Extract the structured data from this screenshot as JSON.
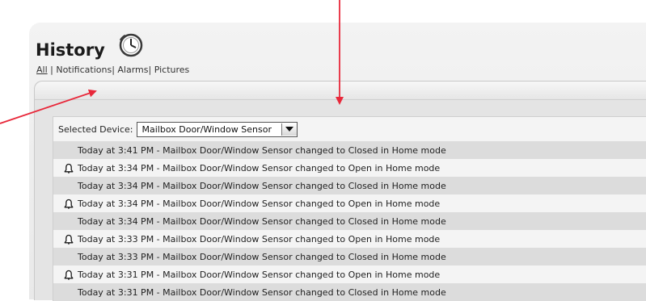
{
  "header": {
    "title": "History",
    "icon": "clock-icon"
  },
  "filters": {
    "all": "All",
    "sep1": " | ",
    "notifications": "Notifications",
    "sep2": "| ",
    "alarms": "Alarms",
    "sep3": "| ",
    "pictures": "Pictures",
    "active": "All"
  },
  "device": {
    "label": "Selected Device:",
    "selected": "Mailbox Door/Window Sensor"
  },
  "events": [
    {
      "text": "Today at 3:41 PM - Mailbox Door/Window Sensor changed to Closed in Home mode",
      "alert": false
    },
    {
      "text": "Today at 3:34 PM - Mailbox Door/Window Sensor changed to Open in Home mode",
      "alert": true
    },
    {
      "text": "Today at 3:34 PM - Mailbox Door/Window Sensor changed to Closed in Home mode",
      "alert": false
    },
    {
      "text": "Today at 3:34 PM - Mailbox Door/Window Sensor changed to Open in Home mode",
      "alert": true
    },
    {
      "text": "Today at 3:34 PM - Mailbox Door/Window Sensor changed to Closed in Home mode",
      "alert": false
    },
    {
      "text": "Today at 3:33 PM - Mailbox Door/Window Sensor changed to Open in Home mode",
      "alert": true
    },
    {
      "text": "Today at 3:33 PM - Mailbox Door/Window Sensor changed to Closed in Home mode",
      "alert": false
    },
    {
      "text": "Today at 3:31 PM - Mailbox Door/Window Sensor changed to Open in Home mode",
      "alert": true
    },
    {
      "text": "Today at 3:31 PM - Mailbox Door/Window Sensor changed to Closed in Home mode",
      "alert": false
    }
  ],
  "colors": {
    "annotation_arrow": "#e8283a"
  }
}
